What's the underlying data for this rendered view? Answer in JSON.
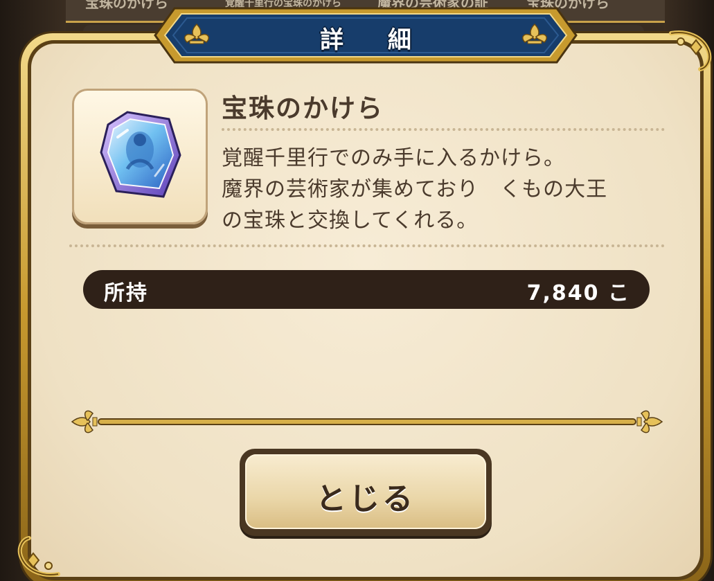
{
  "background": {
    "list_peek_texts": [
      "宝珠のかけら",
      "覚醒千里行の宝珠のかけら",
      "魔界の芸術家の証",
      "宝珠のかけら"
    ]
  },
  "dialog": {
    "title": "詳 細",
    "item": {
      "name": "宝珠のかけら",
      "icon": "gem-shard-icon",
      "description_lines": [
        "覚醒千里行でのみ手に入るかけら。",
        "魔界の芸術家が集めており　くもの大王",
        "の宝珠と交換してくれる。"
      ]
    },
    "owned": {
      "label": "所持",
      "value": "7,840 こ"
    },
    "close_label": "とじる"
  },
  "colors": {
    "panel": "#efe1c4",
    "gold_frame": "#c7992f",
    "title_banner": "#163a66",
    "text_brown": "#4a3a2c",
    "owned_bar": "#2f2118"
  }
}
